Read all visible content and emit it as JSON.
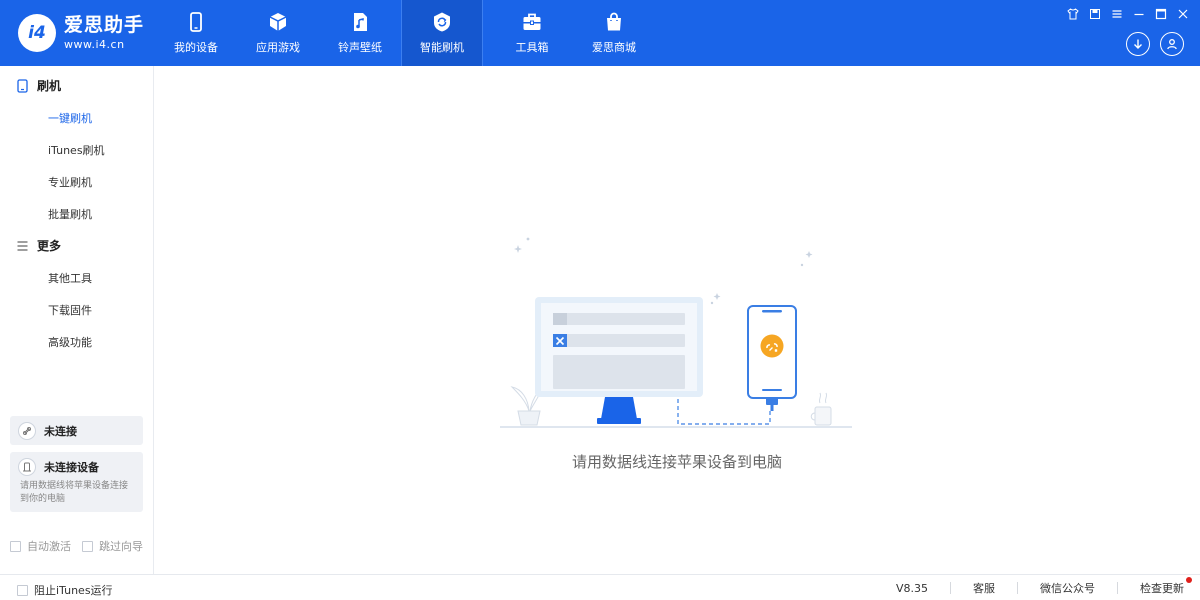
{
  "app": {
    "name": "爱思助手",
    "url": "www.i4.cn",
    "logo_mark": "i4"
  },
  "nav": [
    {
      "label": "我的设备",
      "icon": "phone-icon"
    },
    {
      "label": "应用游戏",
      "icon": "cube-icon"
    },
    {
      "label": "铃声壁纸",
      "icon": "music-file-icon"
    },
    {
      "label": "智能刷机",
      "icon": "refresh-shield-icon",
      "active": true
    },
    {
      "label": "工具箱",
      "icon": "toolbox-icon"
    },
    {
      "label": "爱思商城",
      "icon": "shopping-bag-icon"
    }
  ],
  "sidebar": {
    "section_flash": "刷机",
    "flash_items": [
      "一键刷机",
      "iTunes刷机",
      "专业刷机",
      "批量刷机"
    ],
    "section_more": "更多",
    "more_items": [
      "其他工具",
      "下载固件",
      "高级功能"
    ],
    "connection_status": "未连接",
    "device_status": "未连接设备",
    "device_hint": "请用数据线将苹果设备连接到你的电脑",
    "auto_activate": "自动激活",
    "skip_guide": "跳过向导"
  },
  "main": {
    "message": "请用数据线连接苹果设备到电脑"
  },
  "footer": {
    "block_itunes": "阻止iTunes运行",
    "version": "V8.35",
    "support": "客服",
    "wechat": "微信公众号",
    "check_update": "检查更新"
  },
  "colors": {
    "brand_blue": "#1a64e8",
    "active_text": "#1a64e8",
    "badge_red": "#e0201b",
    "illustration_orange": "#f6a623"
  }
}
